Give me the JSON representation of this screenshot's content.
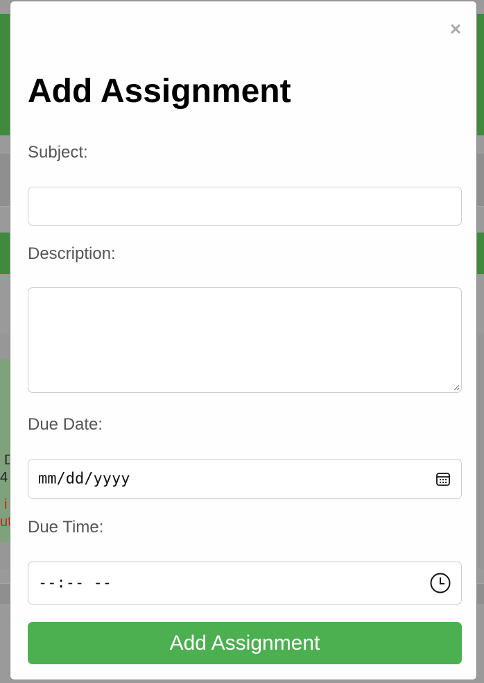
{
  "background": {
    "fragments": [
      {
        "text": "D",
        "color": "#222222"
      },
      {
        "text": "4",
        "color": "#222222"
      },
      {
        "text": "i",
        "color": "#cc1f1f"
      },
      {
        "text": "ut",
        "color": "#cc1f1f"
      }
    ],
    "colors": {
      "header": "#3f8a3c",
      "overlay": "#9a9a9a"
    }
  },
  "modal": {
    "close_icon": "close-icon",
    "close_glyph": "×",
    "title": "Add Assignment",
    "fields": {
      "subject": {
        "label": "Subject:",
        "value": "",
        "placeholder": ""
      },
      "description": {
        "label": "Description:",
        "value": "",
        "placeholder": ""
      },
      "due_date": {
        "label": "Due Date:",
        "display": "mm/dd/yyyy",
        "icon": "calendar-icon"
      },
      "due_time": {
        "label": "Due Time:",
        "display": "--:-- --",
        "icon": "clock-icon"
      }
    },
    "submit_label": "Add Assignment",
    "colors": {
      "accent": "#4caf50",
      "label": "#555555",
      "border": "#cccccc"
    }
  }
}
